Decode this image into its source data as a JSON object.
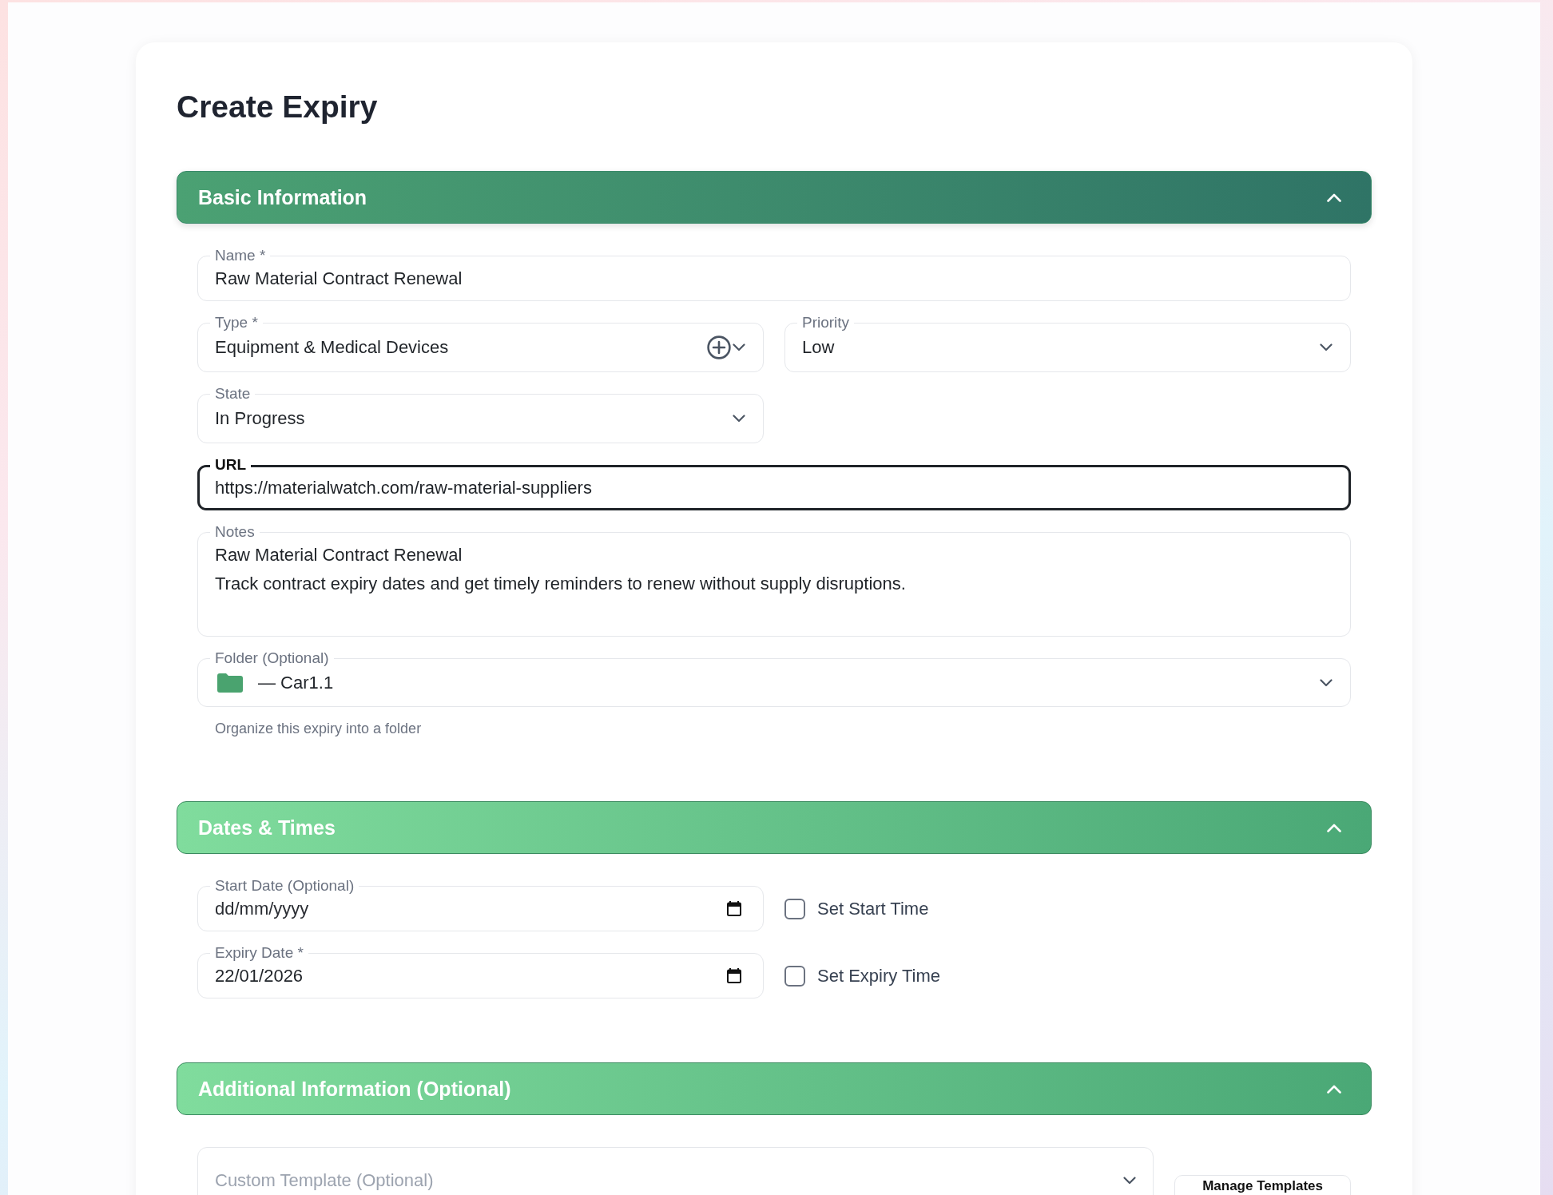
{
  "page": {
    "title": "Create Expiry"
  },
  "sections": [
    {
      "title": "Basic Information",
      "active": true,
      "expanded": true,
      "fields": [
        {
          "kind": "text",
          "label": "Name *",
          "value": "Raw Material Contract Renewal",
          "focused": false
        },
        {
          "kind": "select",
          "label": "Type *",
          "value": "Equipment & Medical Devices",
          "add_button": true,
          "focused": false
        },
        {
          "kind": "select",
          "label": "Priority",
          "value": "Low",
          "add_button": false,
          "focused": false
        },
        {
          "kind": "select",
          "label": "State",
          "value": "In Progress",
          "add_button": false,
          "focused": false
        },
        {
          "kind": "text",
          "label": "URL",
          "value": "https://materialwatch.com/raw-material-suppliers",
          "focused": true
        },
        {
          "kind": "notes",
          "label": "Notes",
          "value": "Raw Material Contract Renewal\nTrack contract expiry dates and get timely reminders to renew without supply disruptions.",
          "focused": false
        },
        {
          "kind": "folder",
          "label": "Folder (Optional)",
          "value": "— Car1.1",
          "hint": "Organize this expiry into a folder",
          "focused": false
        }
      ]
    },
    {
      "title": "Dates & Times",
      "active": false,
      "expanded": true,
      "fields": [
        {
          "kind": "date",
          "label": "Start Date (Optional)",
          "placeholder": "dd/mm/yyyy",
          "focused": false
        },
        {
          "kind": "checkbox",
          "label": "Set Start Time",
          "checked": false
        },
        {
          "kind": "date",
          "label": "Expiry Date *",
          "value": "22/01/2026",
          "focused": false
        },
        {
          "kind": "checkbox",
          "label": "Set Expiry Time",
          "checked": false
        }
      ]
    },
    {
      "title": "Additional Information (Optional)",
      "active": false,
      "expanded": true,
      "fields": [
        {
          "kind": "template",
          "placeholder": "Custom Template (Optional)",
          "focused": false
        },
        {
          "kind": "button",
          "label": "Manage Templates"
        }
      ]
    }
  ]
}
